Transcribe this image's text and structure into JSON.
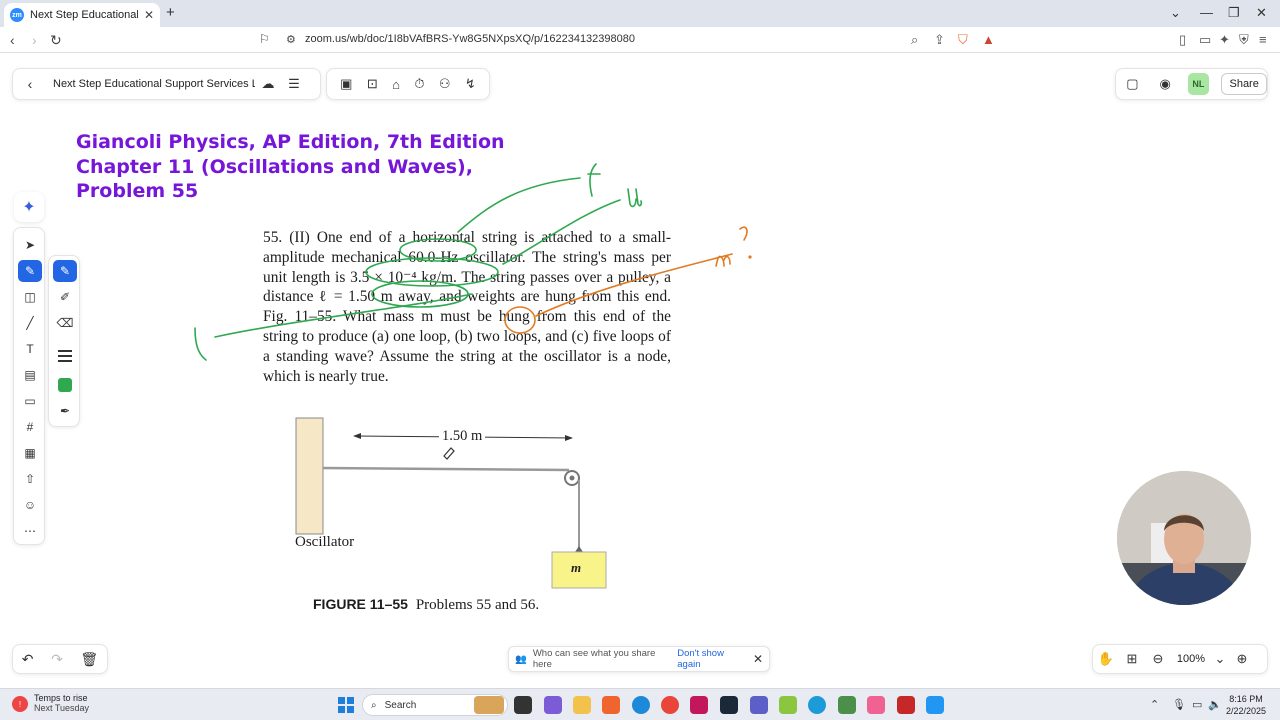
{
  "browser": {
    "tab_title": "Next Step Educational Support",
    "url": "zoom.us/wb/doc/1I8bVAfBRS-Yw8G5NXpsXQ/p/162234132398080"
  },
  "whiteboard": {
    "doc_title": "Next Step Educational Support Services LL...",
    "share_label": "Share",
    "avatar_initials": "NL",
    "heading_lines": [
      "Giancoli Physics, AP Edition, 7th Edition",
      "Chapter 11 (Oscillations and Waves),",
      "Problem 55"
    ],
    "zoom_level": "100%",
    "share_notice": {
      "text": "Who can see what you share here",
      "link": "Don't show again"
    },
    "pen_color": "#2fa84f",
    "accent_color": "#2266e3",
    "heading_color": "#7616d9"
  },
  "problem": {
    "number": "55.",
    "level": "(II)",
    "text": "One end of a horizontal string is attached to a small-amplitude mechanical 60.0-Hz oscillator. The string's mass per unit length is 3.5 × 10⁻⁴ kg/m. The string passes over a pulley, a distance ℓ = 1.50 m away, and weights are hung from this end. Fig. 11–55. What mass m must be hung from this end of the string to produce (a) one loop, (b) two loops, and (c) five loops of a standing wave? Assume the string at the oscillator is a node, which is nearly true.",
    "figure": {
      "distance_label": "1.50 m",
      "oscillator_label": "Oscillator",
      "mass_label": "m",
      "caption_bold": "FIGURE 11–55",
      "caption_text": "Problems 55 and 56."
    }
  },
  "annotations": {
    "f": "f",
    "mu": "μ",
    "l": "l",
    "m_question": "m ?"
  },
  "taskbar": {
    "weather_title": "Temps to rise",
    "weather_sub": "Next Tuesday",
    "search_placeholder": "Search",
    "time": "8:16 PM",
    "date": "2/22/2025"
  }
}
